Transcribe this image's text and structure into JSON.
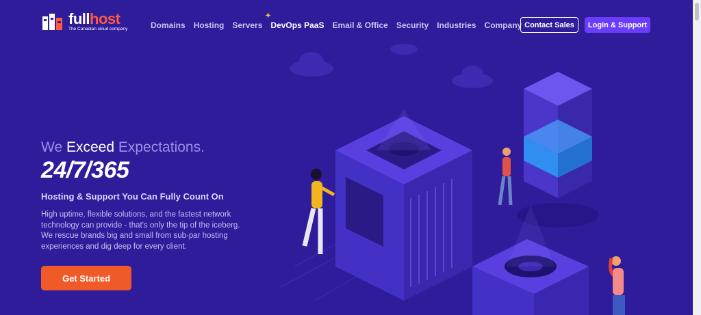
{
  "brand": {
    "name_a": "full",
    "name_b": "host",
    "tagline": "The Canadian cloud company"
  },
  "nav": {
    "items": [
      "Domains",
      "Hosting",
      "Servers",
      "DevOps PaaS",
      "Email & Office",
      "Security",
      "Industries",
      "Company"
    ],
    "contact_label": "Contact Sales",
    "login_label": "Login & Support"
  },
  "hero": {
    "headline_a": "We ",
    "headline_b": "Exceed",
    "headline_c": " Expectations.",
    "big_text": "24/7/365",
    "subheading": "Hosting & Support You Can Fully Count On",
    "description": "High uptime, flexible solutions, and the fastest network technology can provide - that's only the tip of the iceberg. We rescue brands big and small from sub-par hosting experiences and dig deep for every client.",
    "cta_label": "Get Started"
  },
  "colors": {
    "background": "#2f1c9a",
    "accent_orange": "#f05a28",
    "accent_purple": "#6b3dfb"
  }
}
